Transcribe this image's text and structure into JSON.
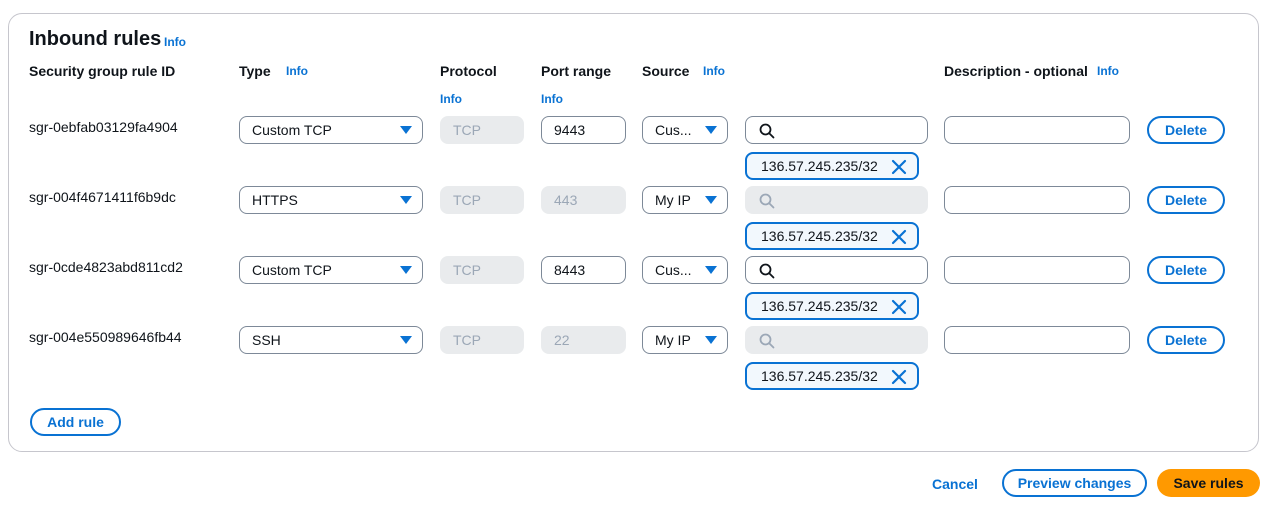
{
  "section": {
    "title": "Inbound rules",
    "info": "Info"
  },
  "columns": {
    "rule_id": "Security group rule ID",
    "type": "Type",
    "type_info": "Info",
    "protocol": "Protocol",
    "protocol_info": "Info",
    "port_range": "Port range",
    "port_range_info": "Info",
    "source": "Source",
    "source_info": "Info",
    "description": "Description - optional",
    "description_info": "Info"
  },
  "rules": [
    {
      "id": "sgr-0ebfab03129fa4904",
      "type": "Custom TCP",
      "protocol": "TCP",
      "port": "9443",
      "source": "Cus...",
      "cidr": "136.57.245.235/32",
      "description": "",
      "delete": "Delete"
    },
    {
      "id": "sgr-004f4671411f6b9dc",
      "type": "HTTPS",
      "protocol": "TCP",
      "port": "443",
      "source": "My IP",
      "cidr": "136.57.245.235/32",
      "description": "",
      "delete": "Delete"
    },
    {
      "id": "sgr-0cde4823abd811cd2",
      "type": "Custom TCP",
      "protocol": "TCP",
      "port": "8443",
      "source": "Cus...",
      "cidr": "136.57.245.235/32",
      "description": "",
      "delete": "Delete"
    },
    {
      "id": "sgr-004e550989646fb44",
      "type": "SSH",
      "protocol": "TCP",
      "port": "22",
      "source": "My IP",
      "cidr": "136.57.245.235/32",
      "description": "",
      "delete": "Delete"
    }
  ],
  "add_rule": "Add rule",
  "footer": {
    "cancel": "Cancel",
    "preview": "Preview changes",
    "save": "Save rules"
  },
  "colors": {
    "accent": "#0972d3",
    "primary": "#ff9900",
    "disabled_bg": "#e9ebed"
  }
}
